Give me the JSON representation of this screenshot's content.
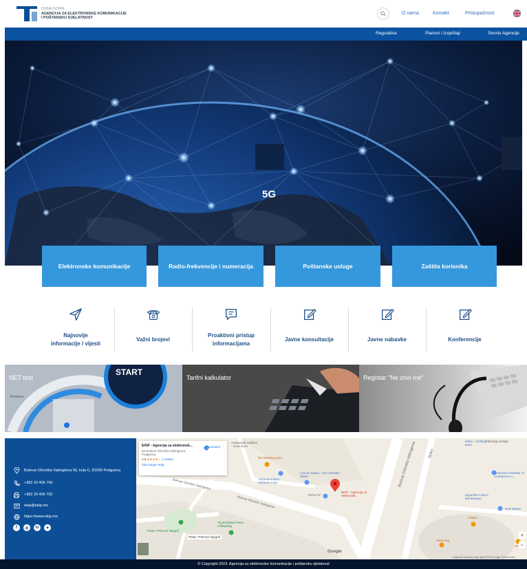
{
  "header": {
    "org_line1": "CRNA GORA",
    "org_line2": "AGENCIJA ZA ELEKTRONSKE KOMUNIKACIJE",
    "org_line3": "I POŠTANSKU DJELATNOST",
    "nav": [
      "O nama",
      "Kontakt",
      "Pristupačnost"
    ],
    "language_icon": "uk-flag-icon",
    "search_icon": "search-icon"
  },
  "main_nav": [
    "Regulativa",
    "Planovi i izvještaji",
    "Servisi Agencije"
  ],
  "hero": {
    "label": "5G"
  },
  "categories": [
    "Elektronske komunikacije",
    "Radio-frekvencije i numeracija",
    "Poštanske usluge",
    "Zaštita korisnika"
  ],
  "quick_links": [
    {
      "line1": "Najnovije",
      "line2": "informacije / vijesti",
      "icon": "send-icon"
    },
    {
      "line1": "Važni brojevi",
      "line2": "",
      "icon": "telephone-icon"
    },
    {
      "line1": "Proaktivni pristup",
      "line2": "informacijama",
      "icon": "message-icon"
    },
    {
      "line1": "Javne konsultacije",
      "line2": "",
      "icon": "edit-icon"
    },
    {
      "line1": "Javne nabavke",
      "line2": "",
      "icon": "edit-icon"
    },
    {
      "line1": "Konferencije",
      "line2": "",
      "icon": "edit-icon"
    }
  ],
  "tiles": [
    {
      "label": "NET test",
      "overlay_start": "START",
      "overlay_previous": "Previous"
    },
    {
      "label": "Tarifni kalkulator"
    },
    {
      "label": "Registar \"Ne zovi me\""
    }
  ],
  "footer": {
    "address": "Bulevar Džordža Vašingtona 56, kula C, 81000 Podgorica",
    "phone": "+382 20 406 700",
    "fax": "+382 20 406 702",
    "email": "ekip@ekip.me",
    "web": "https://www.ekip.me",
    "social_icons": [
      "facebook-icon",
      "instagram-icon",
      "linkedin-icon",
      "twitter-icon"
    ]
  },
  "map": {
    "card_title": "EKIP - Agencija za elektronsk...",
    "card_address": "56 Bulevar Džordža Vašingtona, Podgorica",
    "card_rating": "4.0",
    "card_reviews": "1 review",
    "card_larger_map": "View larger map",
    "card_directions": "Directions",
    "labels": {
      "l1": "Ambasada vodstvo - Crna Gora",
      "l2": "The Meeting point",
      "l3": "Extreme Intimo - Extreme Intim",
      "l4": "Lovćen banka - AD Centrala / Šalter...",
      "l5": "Pizza TV",
      "l6": "EKIP - Agencija za elektronsk...",
      "l7": "Bulevar Džordža Vašingtona",
      "l8": "Bulevar Džordža Vašingtona",
      "l9": "Trg Božidara Petra Cetinjskog",
      "l10": "Petar I Petrović Njegoš",
      "l11": "Petar I Petrović Njegoš",
      "l12": "Mlina - Clothing store",
      "l13": "Flamingo design",
      "l14": "American Chamber of Commerce in...",
      "l15": "Expertise France Montenegro",
      "l16": "NLB Banka",
      "l17": "CINEA",
      "l18": "Samsung",
      "l19": "Google",
      "l20": "Keyboard shortcuts   Map data ©2023 Google   Terms of Use",
      "l21": "Bulevar Džordža Vašingtona",
      "l22": "CH 1",
      "l23": "Bulev"
    },
    "zoom_in": "+",
    "zoom_out": "−"
  },
  "copyright": "© Copyright 2023. Agencija za elektronske komunikacije i poštansku djelatnost",
  "colors": {
    "brand_blue": "#0b52a0",
    "tile_blue": "#3598dc",
    "footer_dark": "#06152e"
  }
}
